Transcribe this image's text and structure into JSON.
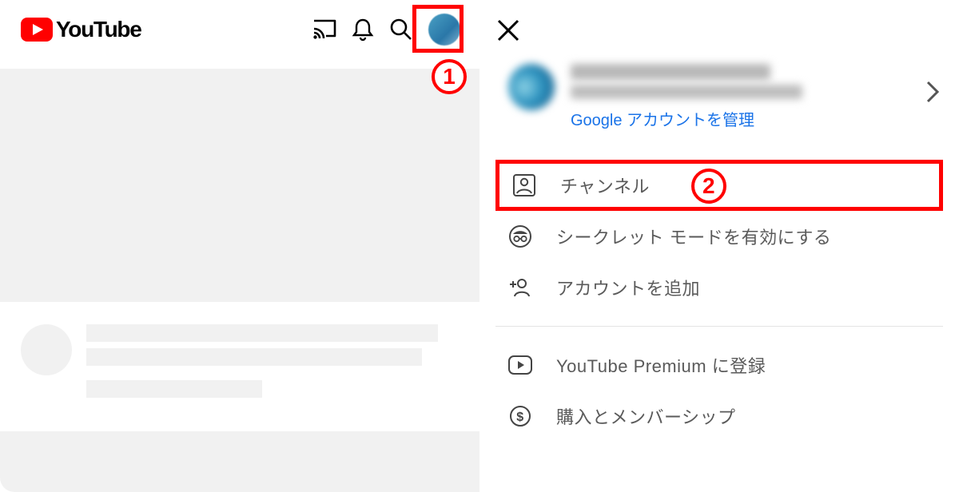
{
  "header": {
    "logo_text": "YouTube"
  },
  "annotations": {
    "num1": "1",
    "num2": "2"
  },
  "account": {
    "manage_label": "Google アカウントを管理"
  },
  "menu": {
    "channel": "チャンネル",
    "incognito": "シークレット モードを有効にする",
    "add_account": "アカウントを追加",
    "premium": "YouTube Premium に登録",
    "purchase": "購入とメンバーシップ"
  }
}
